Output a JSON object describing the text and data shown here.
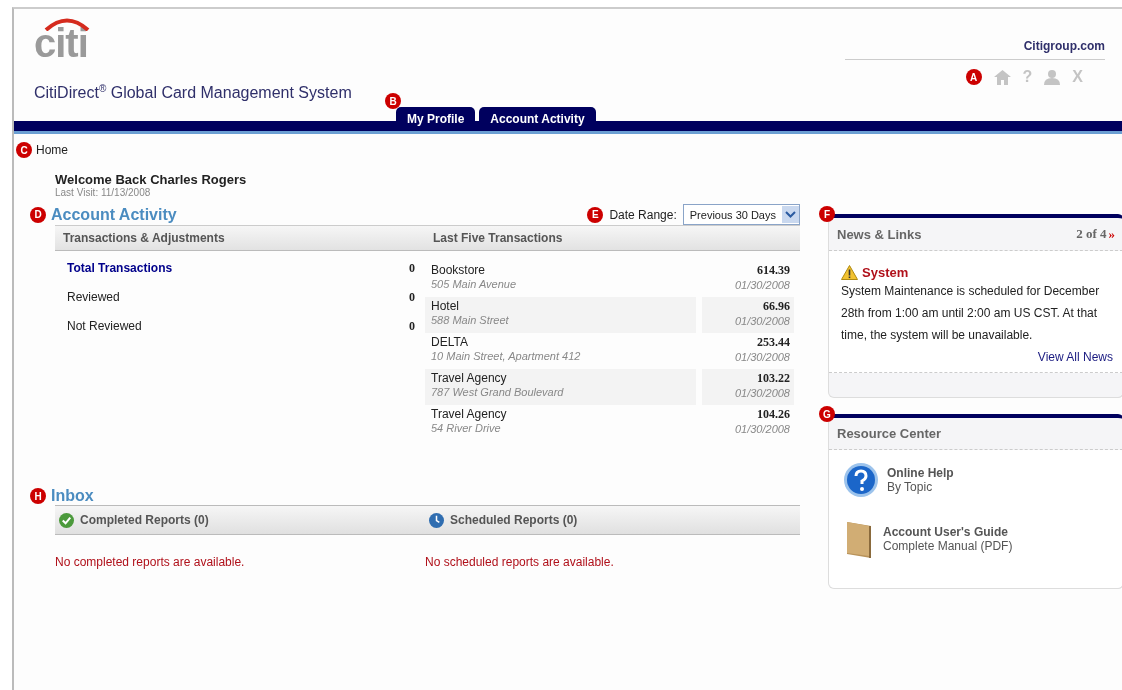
{
  "header": {
    "logo": "citi",
    "title": "CitiDirect$^{®}$ Global Card Management System",
    "link": "Citigroup.com",
    "callout": "A",
    "toolbar": [
      {
        "kind": "home"
      },
      {
        "kind": "help",
        "glyph": "?"
      },
      {
        "kind": "user"
      },
      {
        "kind": "close",
        "glyph": "X"
      }
    ]
  },
  "nav": {
    "callout": "B",
    "tabs": [
      {
        "label": "My Profile"
      },
      {
        "label": "Account Activity"
      }
    ]
  },
  "breadcrumb": {
    "callout": "C",
    "label": "Home"
  },
  "welcome": {
    "title": "Welcome Back Charles Rogers",
    "last_visit": "Last Visit: 11/13/2008"
  },
  "account_activity": {
    "callout": "D",
    "title": "Account Activity",
    "date_range": {
      "callout": "E",
      "label": "Date Range:",
      "value": "Previous 30 Days"
    },
    "columns": [
      "Transactions & Adjustments",
      "Last Five Transactions"
    ],
    "summary": [
      {
        "kind": "link",
        "label": "Total Transactions",
        "value": "0"
      },
      {
        "kind": "plain",
        "label": "Reviewed",
        "value": "0"
      },
      {
        "kind": "plain",
        "label": "Not Reviewed",
        "value": "0"
      }
    ],
    "transactions": [
      {
        "merchant": "Bookstore",
        "address": "505 Main Avenue",
        "amount": "614.39",
        "date": "01/30/2008"
      },
      {
        "merchant": "Hotel",
        "address": "588 Main Street",
        "amount": "66.96",
        "date": "01/30/2008"
      },
      {
        "merchant": "DELTA",
        "address": "10 Main Street, Apartment 412",
        "amount": "253.44",
        "date": "01/30/2008"
      },
      {
        "merchant": "Travel Agency",
        "address": "787 West Grand Boulevard",
        "amount": "103.22",
        "date": "01/30/2008"
      },
      {
        "merchant": "Travel Agency",
        "address": "54 River Drive",
        "amount": "104.26",
        "date": "01/30/2008"
      }
    ]
  },
  "inbox": {
    "callout": "H",
    "title": "Inbox",
    "sections": [
      {
        "kind": "completed",
        "title": "Completed Reports (0)",
        "message": "No completed reports are available."
      },
      {
        "kind": "scheduled",
        "title": "Scheduled Reports (0)",
        "message": "No scheduled reports are available."
      }
    ]
  },
  "news": {
    "callout": "F",
    "title": "News & Links",
    "pager": "2 of 4",
    "next": "»",
    "item_title": "System",
    "body": "System Maintenance is scheduled for December 28th from 1:00 am until 2:00 am US CST. At that time, the system will be unavailable.",
    "link": "View All News"
  },
  "resources": {
    "callout": "G",
    "title": "Resource Center",
    "items": [
      {
        "kind": "help",
        "title": "Online Help",
        "subtitle": "By Topic"
      },
      {
        "kind": "book",
        "title": "Account User's Guide",
        "subtitle": "Complete Manual (PDF)"
      }
    ]
  }
}
